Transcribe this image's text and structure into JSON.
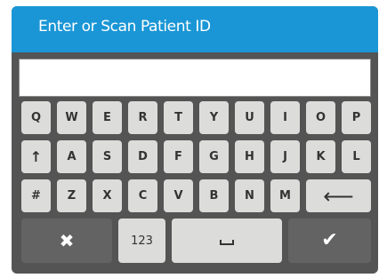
{
  "dialog": {
    "title": "Enter or Scan Patient ID",
    "input_value": ""
  },
  "keyboard": {
    "row1": [
      "Q",
      "W",
      "E",
      "R",
      "T",
      "Y",
      "U",
      "I",
      "O",
      "P"
    ],
    "row2": [
      "A",
      "S",
      "D",
      "F",
      "G",
      "H",
      "J",
      "K",
      "L"
    ],
    "row3": [
      "Z",
      "X",
      "C",
      "V",
      "B",
      "N",
      "M"
    ],
    "shift_symbol": "↑",
    "symbol_key": "#",
    "backspace_symbol": "⟵",
    "cancel_symbol": "✖",
    "numbers_label": "123",
    "confirm_symbol": "✔"
  },
  "colors": {
    "title_bar": "#1a96d6",
    "panel": "#545454",
    "key": "#dcdcda",
    "dark_key": "#636363"
  }
}
